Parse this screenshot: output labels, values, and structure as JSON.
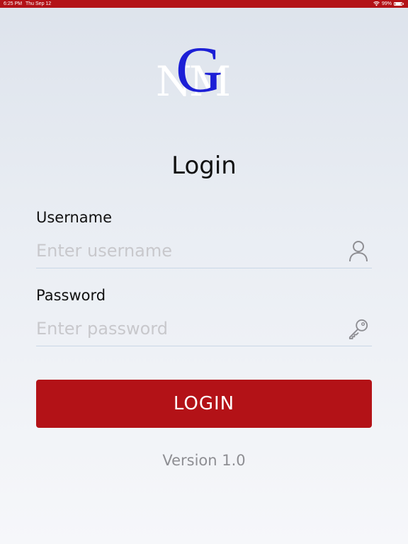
{
  "status_bar": {
    "time": "6:25 PM",
    "date": "Thu Sep 12",
    "battery": "99%",
    "icons": [
      "wifi-icon",
      "battery-icon"
    ],
    "color": "#b31217"
  },
  "logo": {
    "letters_back": "NM",
    "letter_front": "G",
    "front_color": "#1c1fd6",
    "back_color": "#ffffff"
  },
  "title": "Login",
  "username": {
    "label": "Username",
    "placeholder": "Enter username",
    "value": "",
    "icon": "user-icon"
  },
  "password": {
    "label": "Password",
    "placeholder": "Enter password",
    "value": "",
    "icon": "key-icon"
  },
  "login_button": {
    "label": "LOGIN",
    "color": "#b31217"
  },
  "version": "Version 1.0"
}
